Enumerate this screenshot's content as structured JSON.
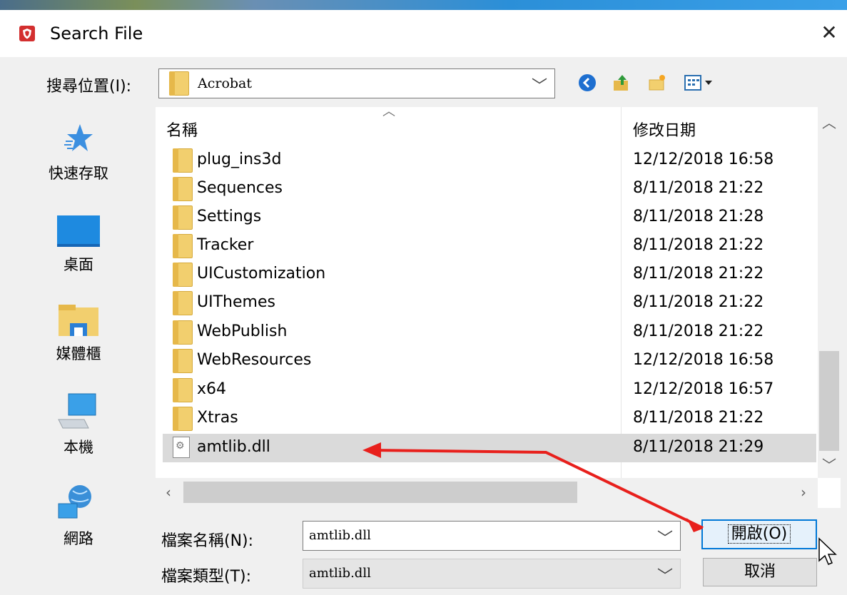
{
  "window": {
    "title": "Search File",
    "close_glyph": "✕"
  },
  "toolbar": {
    "lookin_label": "搜尋位置(I):",
    "lookin_value": "Acrobat",
    "icons": [
      "back-icon",
      "up-folder-icon",
      "new-folder-icon",
      "view-menu-icon"
    ]
  },
  "places": [
    {
      "label": "快速存取",
      "icon": "quick-access-icon"
    },
    {
      "label": "桌面",
      "icon": "desktop-icon"
    },
    {
      "label": "媒體櫃",
      "icon": "libraries-icon"
    },
    {
      "label": "本機",
      "icon": "this-pc-icon"
    },
    {
      "label": "網路",
      "icon": "network-icon"
    }
  ],
  "columns": {
    "name": "名稱",
    "date": "修改日期"
  },
  "files": [
    {
      "name": "plug_ins3d",
      "date": "12/12/2018 16:58",
      "type": "folder"
    },
    {
      "name": "Sequences",
      "date": "8/11/2018 21:22",
      "type": "folder"
    },
    {
      "name": "Settings",
      "date": "8/11/2018 21:28",
      "type": "folder"
    },
    {
      "name": "Tracker",
      "date": "8/11/2018 21:22",
      "type": "folder"
    },
    {
      "name": "UICustomization",
      "date": "8/11/2018 21:22",
      "type": "folder"
    },
    {
      "name": "UIThemes",
      "date": "8/11/2018 21:22",
      "type": "folder"
    },
    {
      "name": "WebPublish",
      "date": "8/11/2018 21:22",
      "type": "folder"
    },
    {
      "name": "WebResources",
      "date": "12/12/2018 16:58",
      "type": "folder"
    },
    {
      "name": "x64",
      "date": "12/12/2018 16:57",
      "type": "folder"
    },
    {
      "name": "Xtras",
      "date": "8/11/2018 21:22",
      "type": "folder"
    },
    {
      "name": "amtlib.dll",
      "date": "8/11/2018 21:29",
      "type": "file",
      "selected": true
    }
  ],
  "bottom": {
    "filename_label": "檔案名稱(N):",
    "filename_value": "amtlib.dll",
    "filetype_label": "檔案類型(T):",
    "filetype_value": "amtlib.dll",
    "open_label": "開啟(O)",
    "cancel_label": "取消"
  },
  "colors": {
    "annotation_arrow": "#e8201c",
    "accent": "#0078d7",
    "app_icon": "#d32f2f"
  }
}
